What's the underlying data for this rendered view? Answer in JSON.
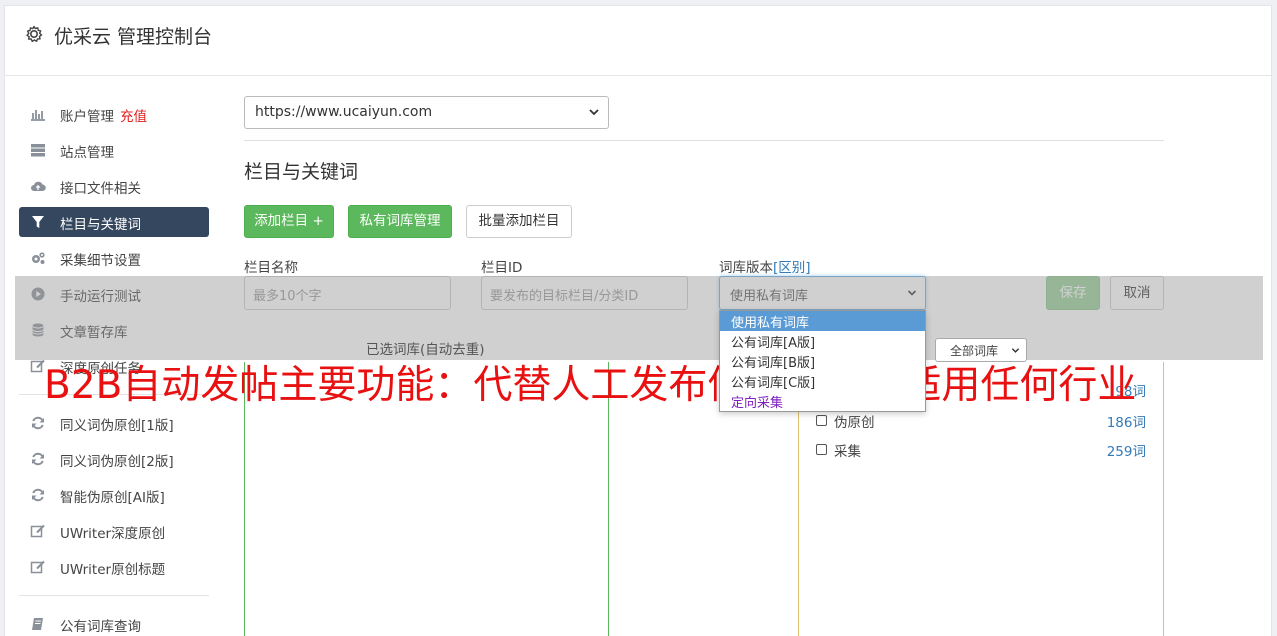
{
  "app": {
    "title": "优采云 管理控制台",
    "icon": "gear-icon"
  },
  "sidebar": {
    "items": [
      {
        "label": "账户管理",
        "badge": "充值",
        "icon": "bar-chart-icon"
      },
      {
        "label": "站点管理",
        "icon": "server-icon"
      },
      {
        "label": "接口文件相关",
        "icon": "cloud-upload-icon"
      },
      {
        "label": "栏目与关键词",
        "icon": "filter-icon",
        "active": true
      },
      {
        "label": "采集细节设置",
        "icon": "cogs-icon"
      },
      {
        "label": "手动运行测试",
        "icon": "play-circle-icon"
      },
      {
        "label": "文章暂存库",
        "icon": "database-icon"
      },
      {
        "label": "深度原创任务",
        "icon": "edit-icon"
      },
      {
        "label": "同义词伪原创[1版]",
        "icon": "refresh-icon"
      },
      {
        "label": "同义词伪原创[2版]",
        "icon": "refresh-icon"
      },
      {
        "label": "智能伪原创[AI版]",
        "icon": "refresh-icon"
      },
      {
        "label": "UWriter深度原创",
        "icon": "edit-icon"
      },
      {
        "label": "UWriter原创标题",
        "icon": "edit-icon"
      },
      {
        "label": "公有词库查询",
        "icon": "book-icon"
      }
    ]
  },
  "main": {
    "site_select": {
      "value": "https://www.ucaiyun.com"
    },
    "section_title": "栏目与关键词",
    "buttons": {
      "add_column": "添加栏目 +",
      "private_lib": "私有词库管理",
      "batch_add": "批量添加栏目",
      "save": "保存",
      "cancel": "取消"
    },
    "form": {
      "name_label": "栏目名称",
      "name_placeholder": "最多10个字",
      "id_label": "栏目ID",
      "id_placeholder": "要发布的目标栏目/分类ID",
      "version_label": "词库版本",
      "version_link": "[区别]",
      "version_value": "使用私有词库",
      "version_options": [
        "使用私有词库",
        "公有词库[A版]",
        "公有词库[B版]",
        "公有词库[C版]",
        "定向采集"
      ]
    },
    "selected_lib_label": "已选词库(自动去重)",
    "lib_filter": "全部词库",
    "libraries": [
      {
        "name": "伪原创",
        "count": "186词"
      },
      {
        "name": "采集",
        "count": "259词"
      }
    ],
    "partial_count": "98词"
  },
  "banner": "B2B自动发帖主要功能：代替人工发布信息，站，适用任何行业",
  "colors": {
    "accent_green": "#5cb85c",
    "sidebar_active": "#34475f",
    "banner_red": "#e81010",
    "link_blue": "#337ab7"
  }
}
